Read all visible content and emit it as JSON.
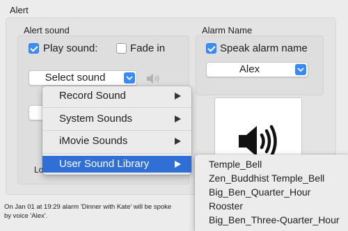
{
  "section": {
    "title": "Alert"
  },
  "alert_sound": {
    "title": "Alert sound",
    "play_sound": {
      "label": "Play sound:",
      "checked": true
    },
    "fade_in": {
      "label": "Fade in",
      "checked": false
    },
    "select_sound": {
      "value": "Select sound"
    },
    "loop_label_partial": "Lo"
  },
  "alarm_name": {
    "title": "Alarm Name",
    "speak": {
      "label": "Speak alarm name",
      "checked": true
    },
    "voice": {
      "value": "Alex"
    }
  },
  "menu": {
    "items": [
      {
        "label": "Record Sound"
      },
      {
        "label": "System Sounds"
      },
      {
        "label": "iMovie Sounds"
      },
      {
        "label": "User Sound Library",
        "active": true
      }
    ]
  },
  "submenu": {
    "items": [
      "Temple_Bell",
      "Zen_Buddhist Temple_Bell",
      "Big_Ben_Quarter_Hour",
      "Rooster",
      "Big_Ben_Three-Quarter_Hour"
    ]
  },
  "footer": {
    "line1": "On Jan 01 at 19:29 alarm 'Dinner with Kate' will be spoke",
    "line2": "by voice 'Alex'."
  },
  "icons": [
    "speaker-preview-icon",
    "speaker-large-icon",
    "chevron-updown-icon",
    "submenu-arrow-icon",
    "checkmark-icon"
  ],
  "colors": {
    "accent": "#3a8af5",
    "menu_highlight": "#2f6fd6"
  }
}
